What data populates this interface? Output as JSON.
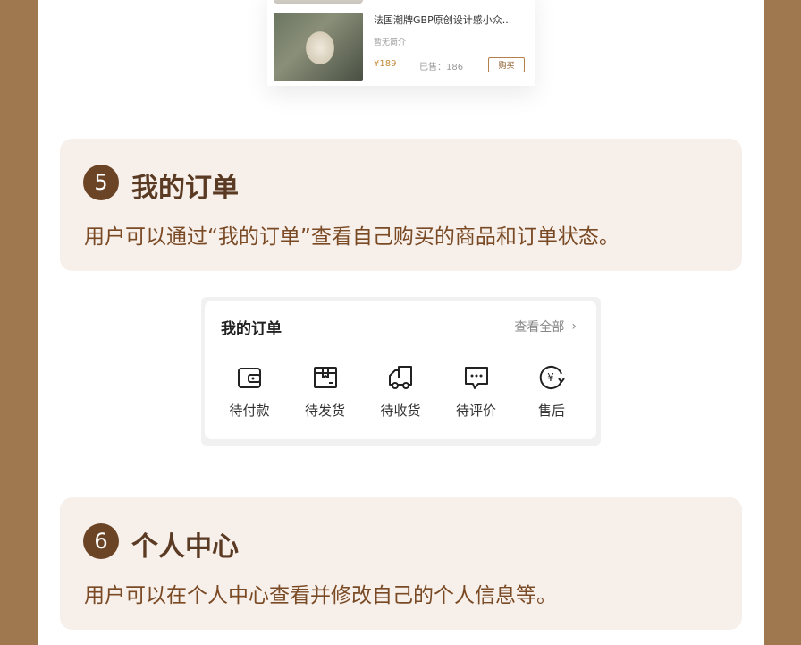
{
  "product": {
    "title": "法国潮牌GBP原创设计感小众...",
    "description": "暂无简介",
    "price": "¥189",
    "sold": "已售：186",
    "buy_label": "购买"
  },
  "sections": [
    {
      "number": "5",
      "title": "我的订单",
      "description": "用户可以通过“我的订单”查看自己购买的商品和订单状态。"
    },
    {
      "number": "6",
      "title": "个人中心",
      "description": "用户可以在个人中心查看并修改自己的个人信息等。"
    }
  ],
  "orders": {
    "title": "我的订单",
    "view_all": "查看全部",
    "items": [
      {
        "label": "待付款",
        "icon": "wallet-icon"
      },
      {
        "label": "待发货",
        "icon": "package-icon"
      },
      {
        "label": "待收货",
        "icon": "truck-icon"
      },
      {
        "label": "待评价",
        "icon": "comment-icon"
      },
      {
        "label": "售后",
        "icon": "refund-icon"
      }
    ]
  },
  "colors": {
    "border": "#a07850",
    "section_bg": "#f6efea",
    "number_badge": "#6b4426",
    "title_text": "#5a3a22",
    "desc_text": "#7a4a25",
    "price": "#c58a3a"
  }
}
